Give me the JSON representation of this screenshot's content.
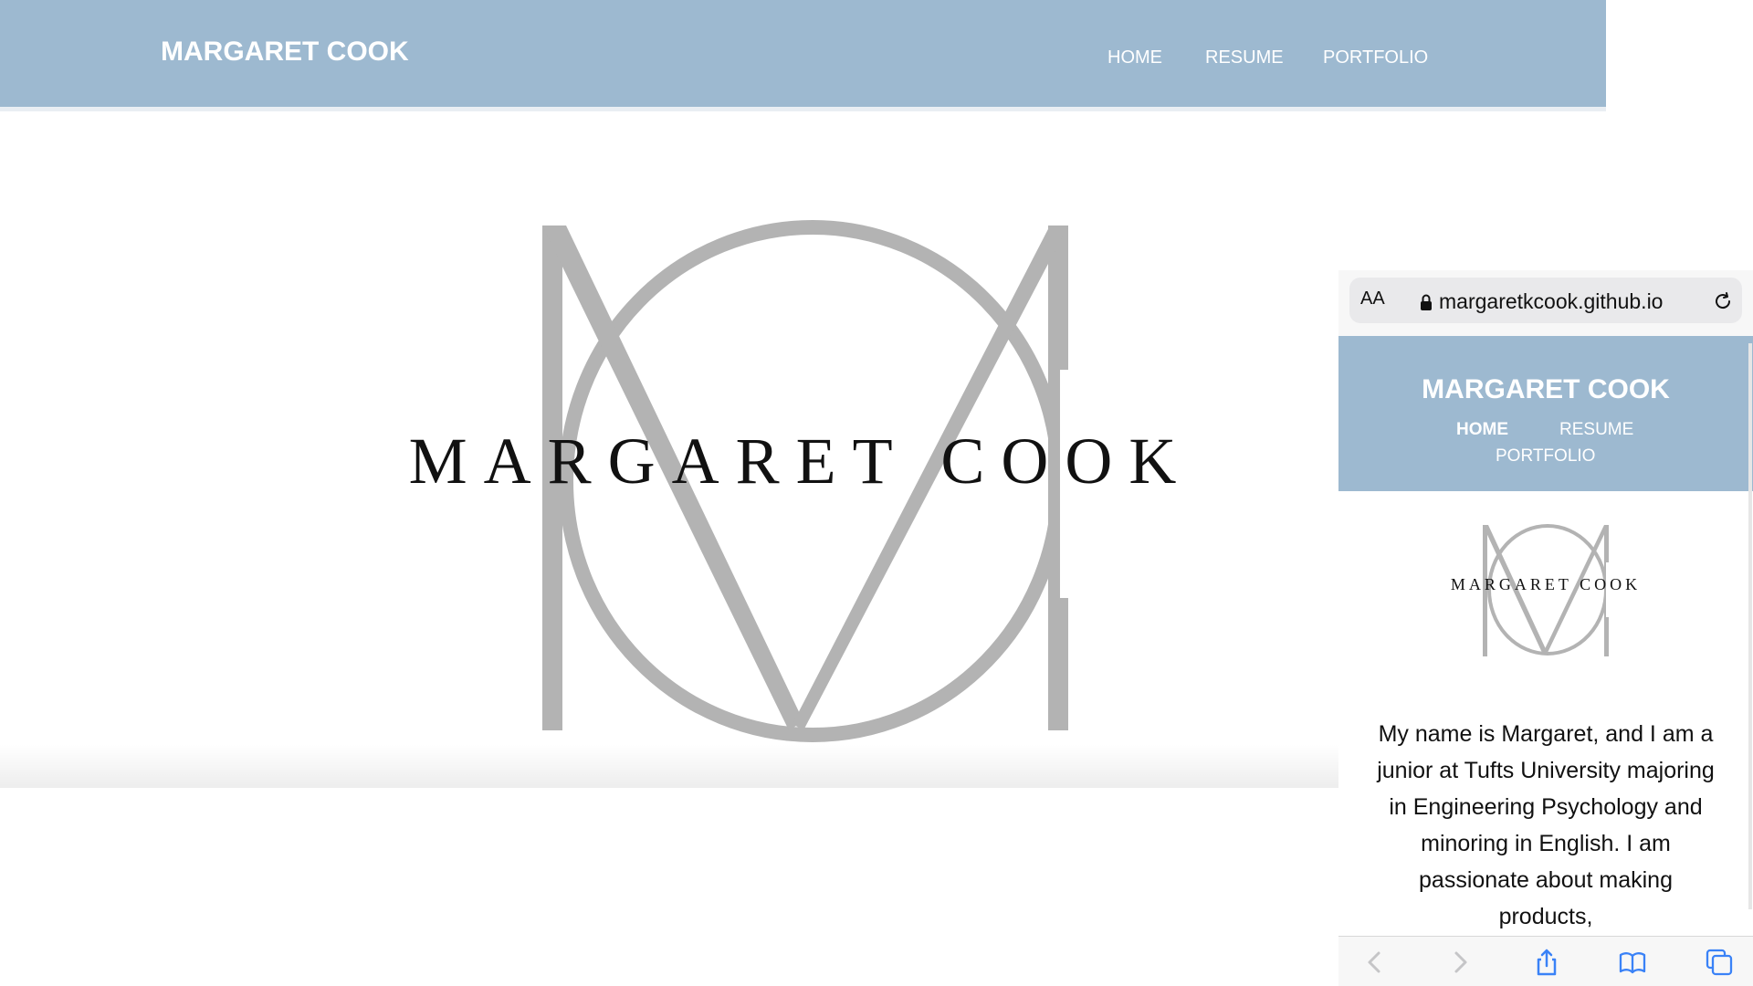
{
  "desktop": {
    "site_title": "MARGARET COOK",
    "nav": {
      "home": "HOME",
      "resume": "RESUME",
      "portfolio": "PORTFOLIO"
    },
    "logo_text": "MARGARET COOK"
  },
  "mobile": {
    "url_bar": {
      "text_size_label": "AA",
      "url": "margaretkcook.github.io"
    },
    "site_title": "MARGARET COOK",
    "nav": {
      "home": "HOME",
      "resume": "RESUME",
      "portfolio": "PORTFOLIO"
    },
    "logo_text": "MARGARET COOK",
    "bio": "My name is Margaret, and I am a junior at Tufts University majoring in Engineering Psychology and minoring in English. I am passionate about making products,"
  },
  "colors": {
    "header_bg": "#9db9d0",
    "monogram_gray": "#b3b3b3",
    "safari_blue": "#3a82f7"
  }
}
